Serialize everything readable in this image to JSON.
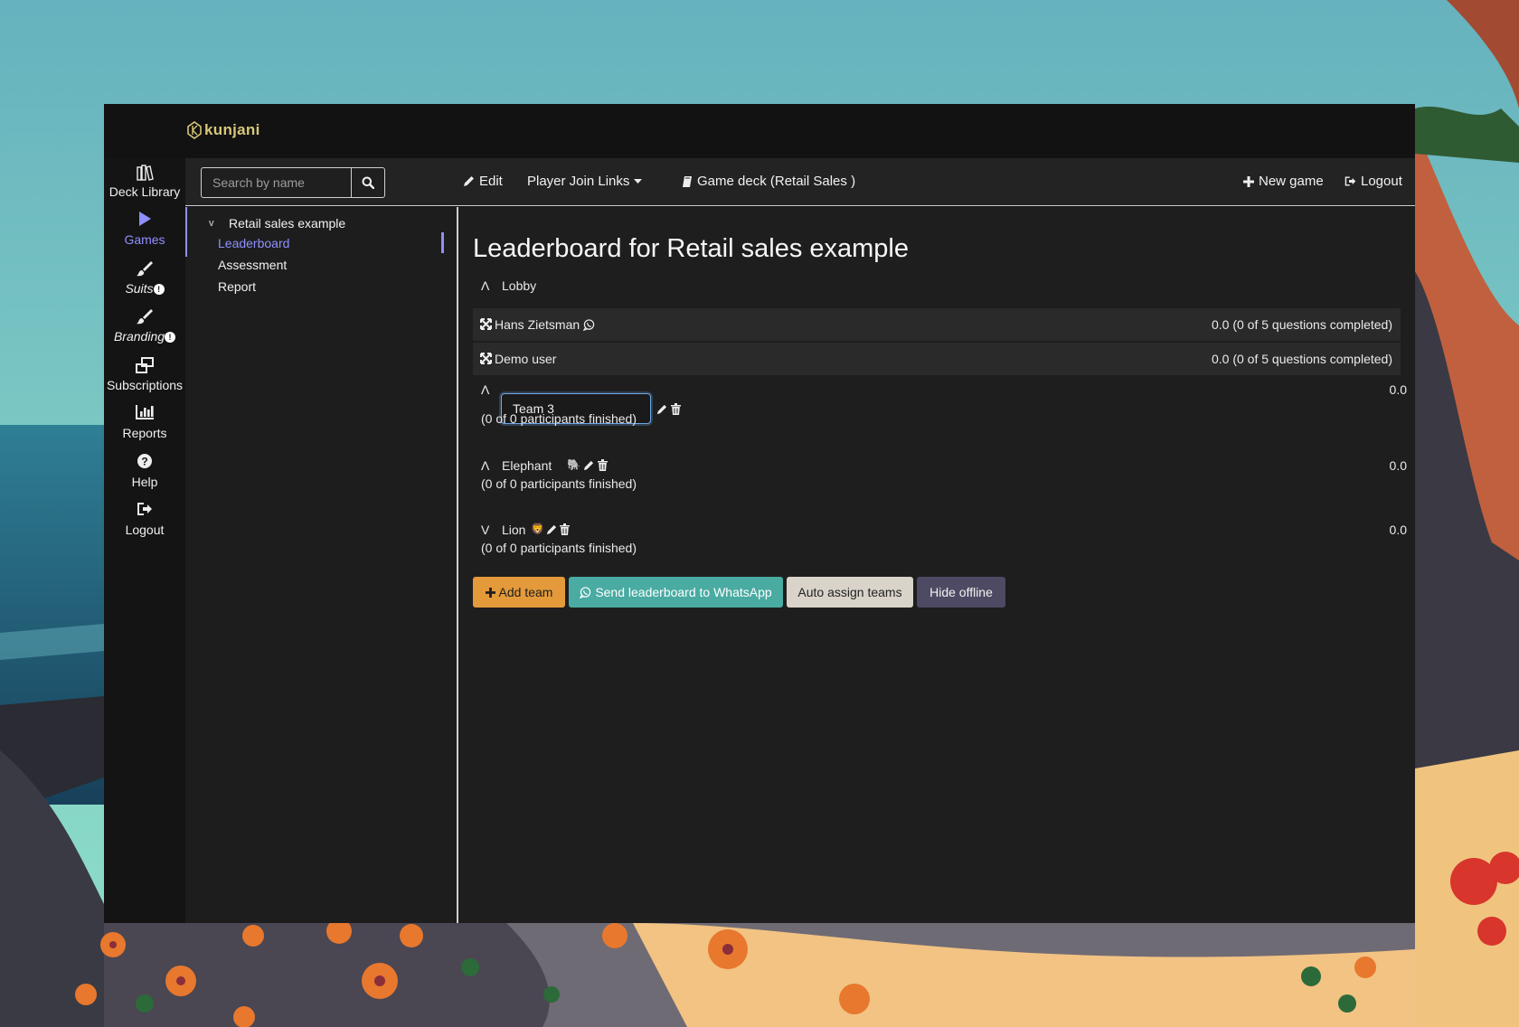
{
  "app": {
    "brand": "kunjani"
  },
  "colors": {
    "accent": "#8f8fff",
    "add_team": "#e49a3a",
    "whatsapp": "#49aba2",
    "auto_assign": "#d9d3ca",
    "hide_offline": "#4e4a63"
  },
  "leftnav": {
    "items": [
      {
        "label": "Deck Library",
        "icon": "books-icon"
      },
      {
        "label": "Games",
        "icon": "play-icon",
        "active": true
      },
      {
        "label": "Suits",
        "icon": "brush-icon",
        "badge": "!"
      },
      {
        "label": "Branding",
        "icon": "brush-icon",
        "badge": "!"
      },
      {
        "label": "Subscriptions",
        "icon": "clone-icon"
      },
      {
        "label": "Reports",
        "icon": "bar-chart-icon"
      },
      {
        "label": "Help",
        "icon": "question-circle-icon"
      },
      {
        "label": "Logout",
        "icon": "sign-out-icon"
      }
    ]
  },
  "toolbar": {
    "search_placeholder": "Search by name",
    "edit": "Edit",
    "player_join_links": "Player Join Links",
    "game_deck": "Game deck (Retail Sales )",
    "new_game": "New game",
    "logout": "Logout"
  },
  "tree": {
    "toggle": "v",
    "root": "Retail sales example",
    "children": [
      "Leaderboard",
      "Assessment",
      "Report"
    ],
    "active_child": "Leaderboard"
  },
  "main": {
    "title": "Leaderboard for Retail sales example",
    "caret_up": "Λ",
    "caret_down": "V",
    "lobby": {
      "label": "Lobby",
      "players": [
        {
          "name": "Hans Zietsman",
          "whatsapp": true,
          "score": "0.0 (0 of 5 questions completed)"
        },
        {
          "name": "Demo user",
          "whatsapp": false,
          "score": "0.0 (0 of 5 questions completed)"
        }
      ]
    },
    "teams": [
      {
        "name": "Team 3",
        "editing": true,
        "score": "0.0",
        "status": "(0 of 0 participants finished)",
        "expanded": true
      },
      {
        "name": "Elephant",
        "emoji": "🐘",
        "score": "0.0",
        "status": "(0 of 0 participants finished)",
        "expanded": true
      },
      {
        "name": "Lion",
        "emoji": "🦁",
        "score": "0.0",
        "status": "(0 of 0 participants finished)",
        "expanded": false
      }
    ],
    "buttons": {
      "add_team": "Add team",
      "send_whatsapp": "Send leaderboard to WhatsApp",
      "auto_assign": "Auto assign teams",
      "hide_offline": "Hide offline"
    }
  }
}
